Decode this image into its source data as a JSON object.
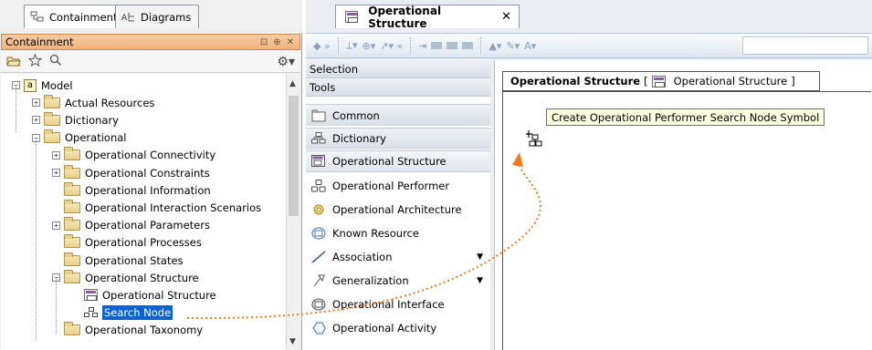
{
  "left": {
    "tabs": [
      {
        "label": "Containment",
        "icon": "containment-icon",
        "active": true
      },
      {
        "label": "Diagrams",
        "icon": "diagrams-icon",
        "active": false
      }
    ],
    "panel_title": "Containment",
    "panel_buttons": [
      "⊡",
      "⊕",
      "✕"
    ],
    "tree": [
      {
        "label": "Model",
        "level": 0,
        "expander": "−",
        "icon": "package"
      },
      {
        "label": "Actual Resources",
        "level": 1,
        "expander": "+",
        "icon": "folder"
      },
      {
        "label": "Dictionary",
        "level": 1,
        "expander": "+",
        "icon": "folder"
      },
      {
        "label": "Operational",
        "level": 1,
        "expander": "−",
        "icon": "folder"
      },
      {
        "label": "Operational Connectivity",
        "level": 2,
        "expander": "+",
        "icon": "folder"
      },
      {
        "label": "Operational Constraints",
        "level": 2,
        "expander": "+",
        "icon": "folder"
      },
      {
        "label": "Operational Information",
        "level": 2,
        "expander": "",
        "icon": "folder"
      },
      {
        "label": "Operational Interaction Scenarios",
        "level": 2,
        "expander": "",
        "icon": "folder"
      },
      {
        "label": "Operational Parameters",
        "level": 2,
        "expander": "+",
        "icon": "folder"
      },
      {
        "label": "Operational Processes",
        "level": 2,
        "expander": "",
        "icon": "folder"
      },
      {
        "label": "Operational States",
        "level": 2,
        "expander": "",
        "icon": "folder"
      },
      {
        "label": "Operational Structure",
        "level": 2,
        "expander": "−",
        "icon": "folder"
      },
      {
        "label": "Operational Structure",
        "level": 3,
        "expander": "",
        "icon": "diagram"
      },
      {
        "label": "Search Node",
        "level": 3,
        "expander": "",
        "icon": "node",
        "selected": true
      },
      {
        "label": "Operational Taxonomy",
        "level": 2,
        "expander": "",
        "icon": "folder"
      }
    ]
  },
  "editor": {
    "tab_label": "Operational Structure",
    "tab_close": "✕",
    "palette": {
      "headers": [
        "Selection",
        "Tools"
      ],
      "items": [
        {
          "label": "Common",
          "icon": "folder",
          "style": "group"
        },
        {
          "label": "Dictionary",
          "icon": "dictionary",
          "style": "group"
        },
        {
          "label": "Operational Structure",
          "icon": "diagram",
          "style": "group-active"
        },
        {
          "label": "Operational Performer",
          "icon": "performer",
          "style": "item"
        },
        {
          "label": "Operational Architecture",
          "icon": "architecture",
          "style": "item"
        },
        {
          "label": "Known Resource",
          "icon": "known-resource",
          "style": "item"
        },
        {
          "label": "Association",
          "icon": "association",
          "style": "item",
          "dropdown": true
        },
        {
          "label": "Generalization",
          "icon": "generalization",
          "style": "item",
          "dropdown": true
        },
        {
          "label": "Operational Interface",
          "icon": "interface",
          "style": "item"
        },
        {
          "label": "Operational Activity",
          "icon": "activity",
          "style": "item"
        }
      ]
    },
    "diagram": {
      "frame_title": "Operational Structure",
      "frame_bracket_open": "[",
      "frame_subtitle": "Operational Structure",
      "frame_bracket_close": "]",
      "tooltip": "Create Operational Performer Search Node Symbol"
    }
  },
  "colors": {
    "selection": "#0a63cf",
    "panel_header": "#f0b37e",
    "callout_arrow": "#f07a1e",
    "tooltip_bg": "#ffffe1"
  }
}
